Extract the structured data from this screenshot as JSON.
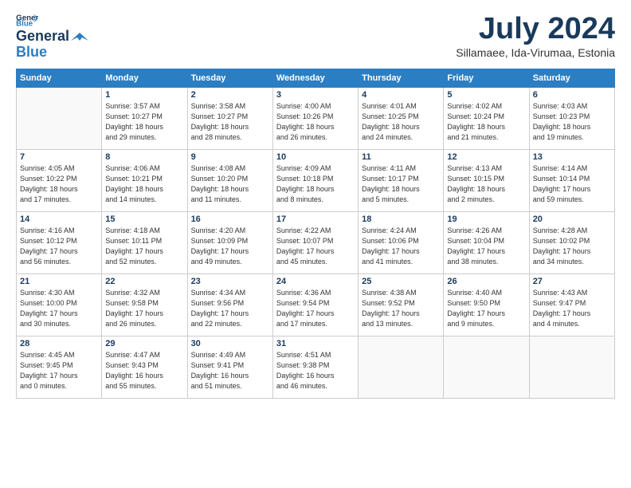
{
  "header": {
    "logo_line1": "General",
    "logo_line2": "Blue",
    "month_title": "July 2024",
    "location": "Sillamaee, Ida-Virumaa, Estonia"
  },
  "weekdays": [
    "Sunday",
    "Monday",
    "Tuesday",
    "Wednesday",
    "Thursday",
    "Friday",
    "Saturday"
  ],
  "weeks": [
    [
      {
        "day": "",
        "info": ""
      },
      {
        "day": "1",
        "info": "Sunrise: 3:57 AM\nSunset: 10:27 PM\nDaylight: 18 hours\nand 29 minutes."
      },
      {
        "day": "2",
        "info": "Sunrise: 3:58 AM\nSunset: 10:27 PM\nDaylight: 18 hours\nand 28 minutes."
      },
      {
        "day": "3",
        "info": "Sunrise: 4:00 AM\nSunset: 10:26 PM\nDaylight: 18 hours\nand 26 minutes."
      },
      {
        "day": "4",
        "info": "Sunrise: 4:01 AM\nSunset: 10:25 PM\nDaylight: 18 hours\nand 24 minutes."
      },
      {
        "day": "5",
        "info": "Sunrise: 4:02 AM\nSunset: 10:24 PM\nDaylight: 18 hours\nand 21 minutes."
      },
      {
        "day": "6",
        "info": "Sunrise: 4:03 AM\nSunset: 10:23 PM\nDaylight: 18 hours\nand 19 minutes."
      }
    ],
    [
      {
        "day": "7",
        "info": "Sunrise: 4:05 AM\nSunset: 10:22 PM\nDaylight: 18 hours\nand 17 minutes."
      },
      {
        "day": "8",
        "info": "Sunrise: 4:06 AM\nSunset: 10:21 PM\nDaylight: 18 hours\nand 14 minutes."
      },
      {
        "day": "9",
        "info": "Sunrise: 4:08 AM\nSunset: 10:20 PM\nDaylight: 18 hours\nand 11 minutes."
      },
      {
        "day": "10",
        "info": "Sunrise: 4:09 AM\nSunset: 10:18 PM\nDaylight: 18 hours\nand 8 minutes."
      },
      {
        "day": "11",
        "info": "Sunrise: 4:11 AM\nSunset: 10:17 PM\nDaylight: 18 hours\nand 5 minutes."
      },
      {
        "day": "12",
        "info": "Sunrise: 4:13 AM\nSunset: 10:15 PM\nDaylight: 18 hours\nand 2 minutes."
      },
      {
        "day": "13",
        "info": "Sunrise: 4:14 AM\nSunset: 10:14 PM\nDaylight: 17 hours\nand 59 minutes."
      }
    ],
    [
      {
        "day": "14",
        "info": "Sunrise: 4:16 AM\nSunset: 10:12 PM\nDaylight: 17 hours\nand 56 minutes."
      },
      {
        "day": "15",
        "info": "Sunrise: 4:18 AM\nSunset: 10:11 PM\nDaylight: 17 hours\nand 52 minutes."
      },
      {
        "day": "16",
        "info": "Sunrise: 4:20 AM\nSunset: 10:09 PM\nDaylight: 17 hours\nand 49 minutes."
      },
      {
        "day": "17",
        "info": "Sunrise: 4:22 AM\nSunset: 10:07 PM\nDaylight: 17 hours\nand 45 minutes."
      },
      {
        "day": "18",
        "info": "Sunrise: 4:24 AM\nSunset: 10:06 PM\nDaylight: 17 hours\nand 41 minutes."
      },
      {
        "day": "19",
        "info": "Sunrise: 4:26 AM\nSunset: 10:04 PM\nDaylight: 17 hours\nand 38 minutes."
      },
      {
        "day": "20",
        "info": "Sunrise: 4:28 AM\nSunset: 10:02 PM\nDaylight: 17 hours\nand 34 minutes."
      }
    ],
    [
      {
        "day": "21",
        "info": "Sunrise: 4:30 AM\nSunset: 10:00 PM\nDaylight: 17 hours\nand 30 minutes."
      },
      {
        "day": "22",
        "info": "Sunrise: 4:32 AM\nSunset: 9:58 PM\nDaylight: 17 hours\nand 26 minutes."
      },
      {
        "day": "23",
        "info": "Sunrise: 4:34 AM\nSunset: 9:56 PM\nDaylight: 17 hours\nand 22 minutes."
      },
      {
        "day": "24",
        "info": "Sunrise: 4:36 AM\nSunset: 9:54 PM\nDaylight: 17 hours\nand 17 minutes."
      },
      {
        "day": "25",
        "info": "Sunrise: 4:38 AM\nSunset: 9:52 PM\nDaylight: 17 hours\nand 13 minutes."
      },
      {
        "day": "26",
        "info": "Sunrise: 4:40 AM\nSunset: 9:50 PM\nDaylight: 17 hours\nand 9 minutes."
      },
      {
        "day": "27",
        "info": "Sunrise: 4:43 AM\nSunset: 9:47 PM\nDaylight: 17 hours\nand 4 minutes."
      }
    ],
    [
      {
        "day": "28",
        "info": "Sunrise: 4:45 AM\nSunset: 9:45 PM\nDaylight: 17 hours\nand 0 minutes."
      },
      {
        "day": "29",
        "info": "Sunrise: 4:47 AM\nSunset: 9:43 PM\nDaylight: 16 hours\nand 55 minutes."
      },
      {
        "day": "30",
        "info": "Sunrise: 4:49 AM\nSunset: 9:41 PM\nDaylight: 16 hours\nand 51 minutes."
      },
      {
        "day": "31",
        "info": "Sunrise: 4:51 AM\nSunset: 9:38 PM\nDaylight: 16 hours\nand 46 minutes."
      },
      {
        "day": "",
        "info": ""
      },
      {
        "day": "",
        "info": ""
      },
      {
        "day": "",
        "info": ""
      }
    ]
  ]
}
